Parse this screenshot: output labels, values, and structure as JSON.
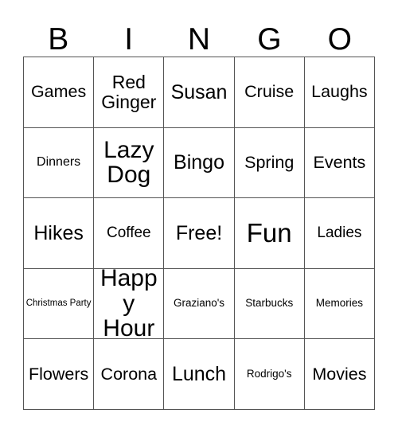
{
  "card": {
    "title_letters": [
      "B",
      "I",
      "N",
      "G",
      "O"
    ],
    "border_color": "#555555",
    "text_color": "#000000",
    "background_color": "#ffffff",
    "rows": [
      [
        {
          "text": "Games",
          "size": "xl"
        },
        {
          "text": "Red Ginger",
          "size": "2xl"
        },
        {
          "text": "Susan",
          "size": "3xl"
        },
        {
          "text": "Cruise",
          "size": "xl"
        },
        {
          "text": "Laughs",
          "size": "xl"
        }
      ],
      [
        {
          "text": "Dinners",
          "size": "md"
        },
        {
          "text": "Lazy Dog",
          "size": "4xl"
        },
        {
          "text": "Bingo",
          "size": "3xl"
        },
        {
          "text": "Spring",
          "size": "xl"
        },
        {
          "text": "Events",
          "size": "xl"
        }
      ],
      [
        {
          "text": "Hikes",
          "size": "3xl"
        },
        {
          "text": "Coffee",
          "size": "lg"
        },
        {
          "text": "Free!",
          "size": "3xl"
        },
        {
          "text": "Fun",
          "size": "5xl"
        },
        {
          "text": "Ladies",
          "size": "lg"
        }
      ],
      [
        {
          "text": "Christmas Party",
          "size": "xs"
        },
        {
          "text": "Happy Hour",
          "size": "4xl"
        },
        {
          "text": "Graziano's",
          "size": "sm"
        },
        {
          "text": "Starbucks",
          "size": "sm"
        },
        {
          "text": "Memories",
          "size": "sm"
        }
      ],
      [
        {
          "text": "Flowers",
          "size": "xl"
        },
        {
          "text": "Corona",
          "size": "xl"
        },
        {
          "text": "Lunch",
          "size": "3xl"
        },
        {
          "text": "Rodrigo's",
          "size": "sm"
        },
        {
          "text": "Movies",
          "size": "xl"
        }
      ]
    ]
  }
}
